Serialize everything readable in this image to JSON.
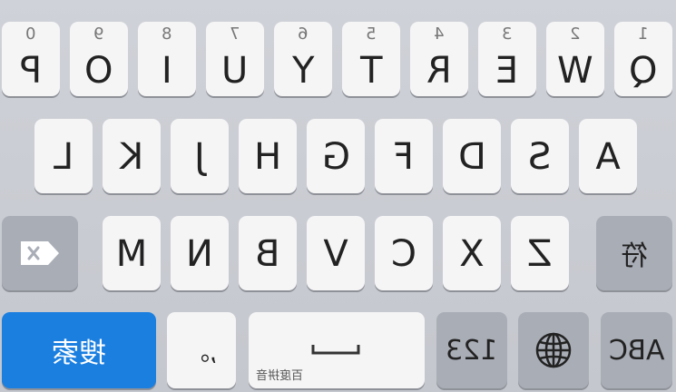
{
  "keyboard": {
    "row1": [
      {
        "letter": "P",
        "num": "0"
      },
      {
        "letter": "O",
        "num": "9"
      },
      {
        "letter": "I",
        "num": "8"
      },
      {
        "letter": "U",
        "num": "7"
      },
      {
        "letter": "Y",
        "num": "6"
      },
      {
        "letter": "T",
        "num": "5"
      },
      {
        "letter": "R",
        "num": "4"
      },
      {
        "letter": "E",
        "num": "3"
      },
      {
        "letter": "W",
        "num": "2"
      },
      {
        "letter": "Q",
        "num": "1"
      }
    ],
    "row2": [
      "L",
      "K",
      "J",
      "H",
      "G",
      "F",
      "D",
      "S",
      "A"
    ],
    "row3": [
      "M",
      "N",
      "B",
      "V",
      "C",
      "X",
      "Z"
    ],
    "shift_label": "符",
    "backspace_icon": "backspace-icon",
    "search_label": "搜索",
    "punct_label": ",。",
    "space_label": "百度拼音",
    "num_label": "123",
    "globe_icon": "globe-icon",
    "abc_label": "ABC",
    "colors": {
      "search_key": "#1b7fe0",
      "dark_key": "#a9adb6",
      "light_key": "#f5f5f6"
    }
  }
}
